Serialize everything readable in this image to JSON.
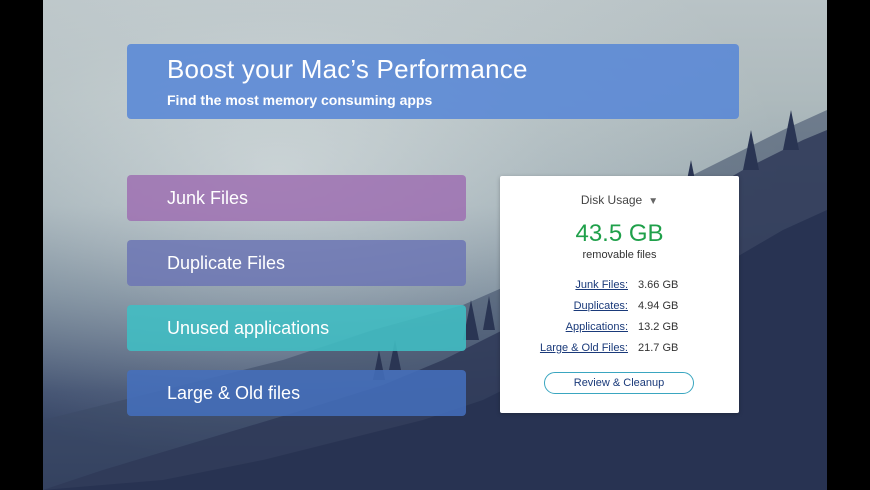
{
  "header": {
    "title": "Boost your Mac’s Performance",
    "subtitle": "Find the most memory consuming apps"
  },
  "categories": [
    {
      "label": "Junk Files",
      "color": "#9e70b2"
    },
    {
      "label": "Duplicate Files",
      "color": "#6c76b4"
    },
    {
      "label": "Unused applications",
      "color": "#40bec4"
    },
    {
      "label": "Large & Old files",
      "color": "#4470be"
    }
  ],
  "disk_panel": {
    "dropdown_label": "Disk Usage",
    "dropdown_icon": "triangle-down-icon",
    "total": "43.5 GB",
    "total_caption": "removable files",
    "total_color": "#1fa04a",
    "rows": [
      {
        "label": "Junk Files:",
        "value": "3.66 GB"
      },
      {
        "label": "Duplicates:",
        "value": "4.94 GB"
      },
      {
        "label": "Applications:",
        "value": "13.2 GB"
      },
      {
        "label": "Large & Old Files:",
        "value": "21.7 GB"
      }
    ],
    "review_button": "Review & Cleanup"
  }
}
